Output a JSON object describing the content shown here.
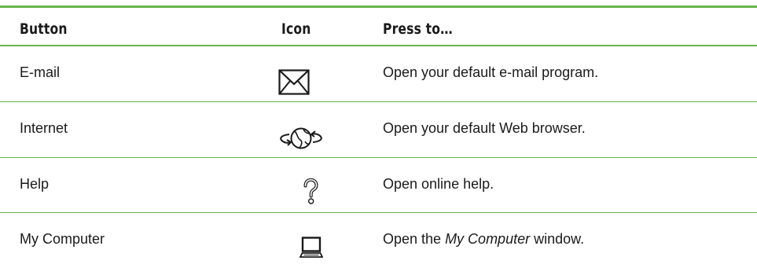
{
  "table": {
    "headers": {
      "button": "Button",
      "icon": "Icon",
      "press_to": "Press to…"
    },
    "rows": [
      {
        "button": "E-mail",
        "icon": "envelope-icon",
        "press_to": "Open your default e-mail program."
      },
      {
        "button": "Internet",
        "icon": "globe-arrows-icon",
        "press_to": "Open your default Web browser."
      },
      {
        "button": "Help",
        "icon": "question-mark-icon",
        "press_to": "Open online help."
      },
      {
        "button": "My Computer",
        "icon": "laptop-icon",
        "press_to_prefix": "Open the ",
        "press_to_italic": "My Computer",
        "press_to_suffix": " window."
      }
    ]
  },
  "colors": {
    "rule": "#69b34c",
    "text": "#1a1a1a"
  }
}
